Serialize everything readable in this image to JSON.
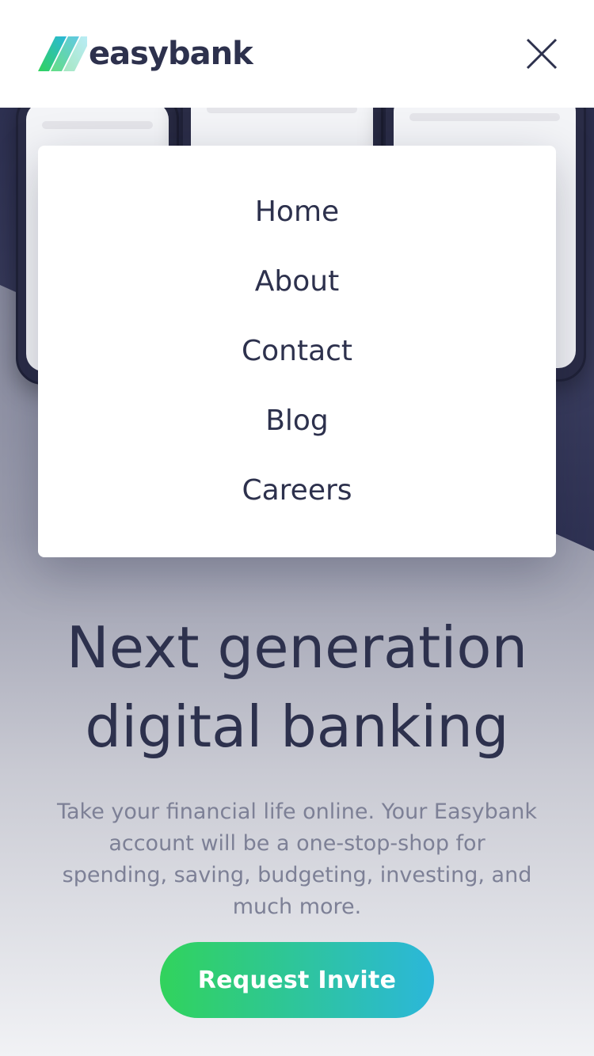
{
  "header": {
    "logo_text": "easybank",
    "close_icon": "close-icon"
  },
  "menu": {
    "items": [
      {
        "label": "Home"
      },
      {
        "label": "About"
      },
      {
        "label": "Contact"
      },
      {
        "label": "Blog"
      },
      {
        "label": "Careers"
      }
    ]
  },
  "hero": {
    "headline_line1": "Next generation",
    "headline_line2": "digital banking",
    "subtext": "Take your financial life online. Your Easybank account will be a one-stop-shop for spending, saving, budgeting, investing, and much more.",
    "cta_label": "Request Invite"
  },
  "colors": {
    "dark_blue": "#2d314d",
    "grayish_blue": "#7d8096",
    "lime_green": "#31d35c",
    "bright_cyan": "#2bb7da"
  }
}
